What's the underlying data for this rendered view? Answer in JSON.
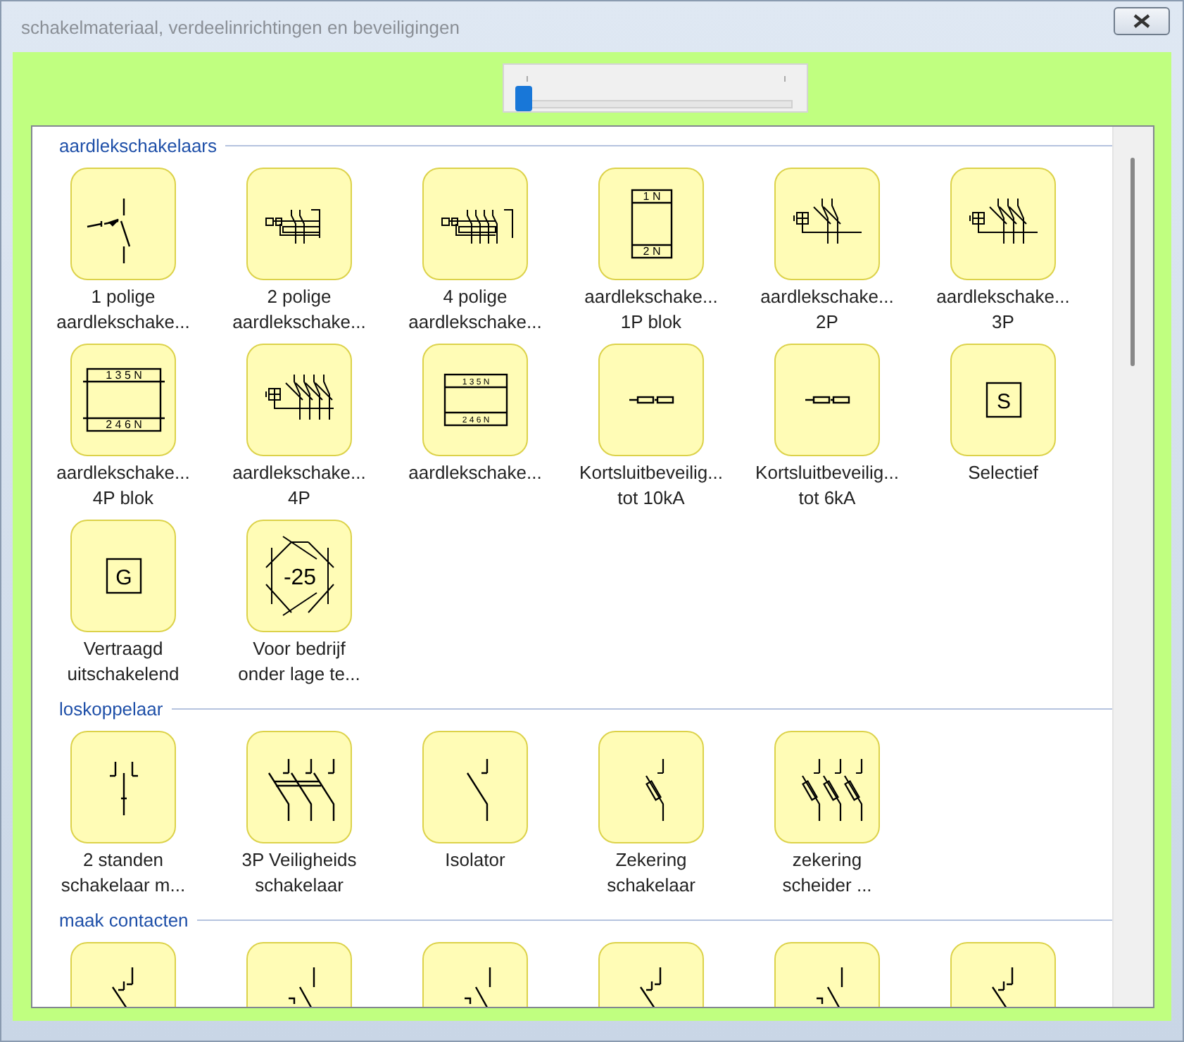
{
  "window": {
    "title": "schakelmateriaal, verdeelinrichtingen en beveiligingen"
  },
  "zoom_slider": {
    "level": 0.0
  },
  "sections": [
    {
      "title": "aardlekschakelaars",
      "items": [
        {
          "label": [
            "1 polige",
            "aardlekschake..."
          ],
          "symbol": {
            "kind": "switch"
          }
        },
        {
          "label": [
            "2 polige",
            "aardlekschake..."
          ],
          "symbol": {
            "kind": "rcd-detail-2p"
          }
        },
        {
          "label": [
            "4 polige",
            "aardlekschake..."
          ],
          "symbol": {
            "kind": "rcd-detail-4p"
          }
        },
        {
          "label": [
            "aardlekschake...",
            "1P blok"
          ],
          "symbol": {
            "kind": "block-narrow",
            "top": "1 N",
            "bottom": "2 N"
          }
        },
        {
          "label": [
            "aardlekschake...",
            "2P"
          ],
          "symbol": {
            "kind": "rcd-2p"
          }
        },
        {
          "label": [
            "aardlekschake...",
            "3P"
          ],
          "symbol": {
            "kind": "rcd-3p"
          }
        },
        {
          "label": [
            "aardlekschake...",
            "4P blok"
          ],
          "symbol": {
            "kind": "block-wide",
            "top": "1 3 5 N",
            "bottom": "2 4 6 N"
          }
        },
        {
          "label": [
            "aardlekschake...",
            "4P"
          ],
          "symbol": {
            "kind": "rcd-4p"
          }
        },
        {
          "label": [
            "aardlekschake..."
          ],
          "symbol": {
            "kind": "block-small",
            "top": "1 3 5 N",
            "bottom": "2 4 6 N"
          }
        },
        {
          "label": [
            "Kortsluitbeveilig...",
            "tot 10kA"
          ],
          "symbol": {
            "kind": "fuse"
          }
        },
        {
          "label": [
            "Kortsluitbeveilig...",
            "tot 6kA"
          ],
          "symbol": {
            "kind": "fuse"
          }
        },
        {
          "label": [
            "Selectief"
          ],
          "symbol": {
            "kind": "letter",
            "text": "S"
          }
        },
        {
          "label": [
            "Vertraagd",
            "uitschakelend"
          ],
          "symbol": {
            "kind": "letter",
            "text": "G"
          }
        },
        {
          "label": [
            "Voor bedrijf",
            "onder lage te..."
          ],
          "symbol": {
            "kind": "hexagon",
            "text": "-25"
          }
        }
      ]
    },
    {
      "title": "loskoppelaar",
      "items": [
        {
          "label": [
            "2 standen",
            "schakelaar m..."
          ],
          "symbol": {
            "kind": "changeover"
          }
        },
        {
          "label": [
            "3P Veiligheids",
            "schakelaar"
          ],
          "symbol": {
            "kind": "isolator-3p"
          }
        },
        {
          "label": [
            "Isolator"
          ],
          "symbol": {
            "kind": "isolator"
          }
        },
        {
          "label": [
            "Zekering",
            "schakelaar"
          ],
          "symbol": {
            "kind": "fuse-switch"
          }
        },
        {
          "label": [
            "zekering",
            "scheider ..."
          ],
          "symbol": {
            "kind": "fuse-switch-3p"
          }
        }
      ]
    },
    {
      "title": "maak contacten",
      "items": [
        {
          "symbol": {
            "kind": "contact"
          }
        },
        {
          "symbol": {
            "kind": "contact-bracket"
          }
        },
        {
          "symbol": {
            "kind": "contact-bracket"
          }
        },
        {
          "symbol": {
            "kind": "contact"
          }
        },
        {
          "symbol": {
            "kind": "contact-bracket"
          }
        },
        {
          "symbol": {
            "kind": "contact"
          }
        }
      ]
    }
  ]
}
